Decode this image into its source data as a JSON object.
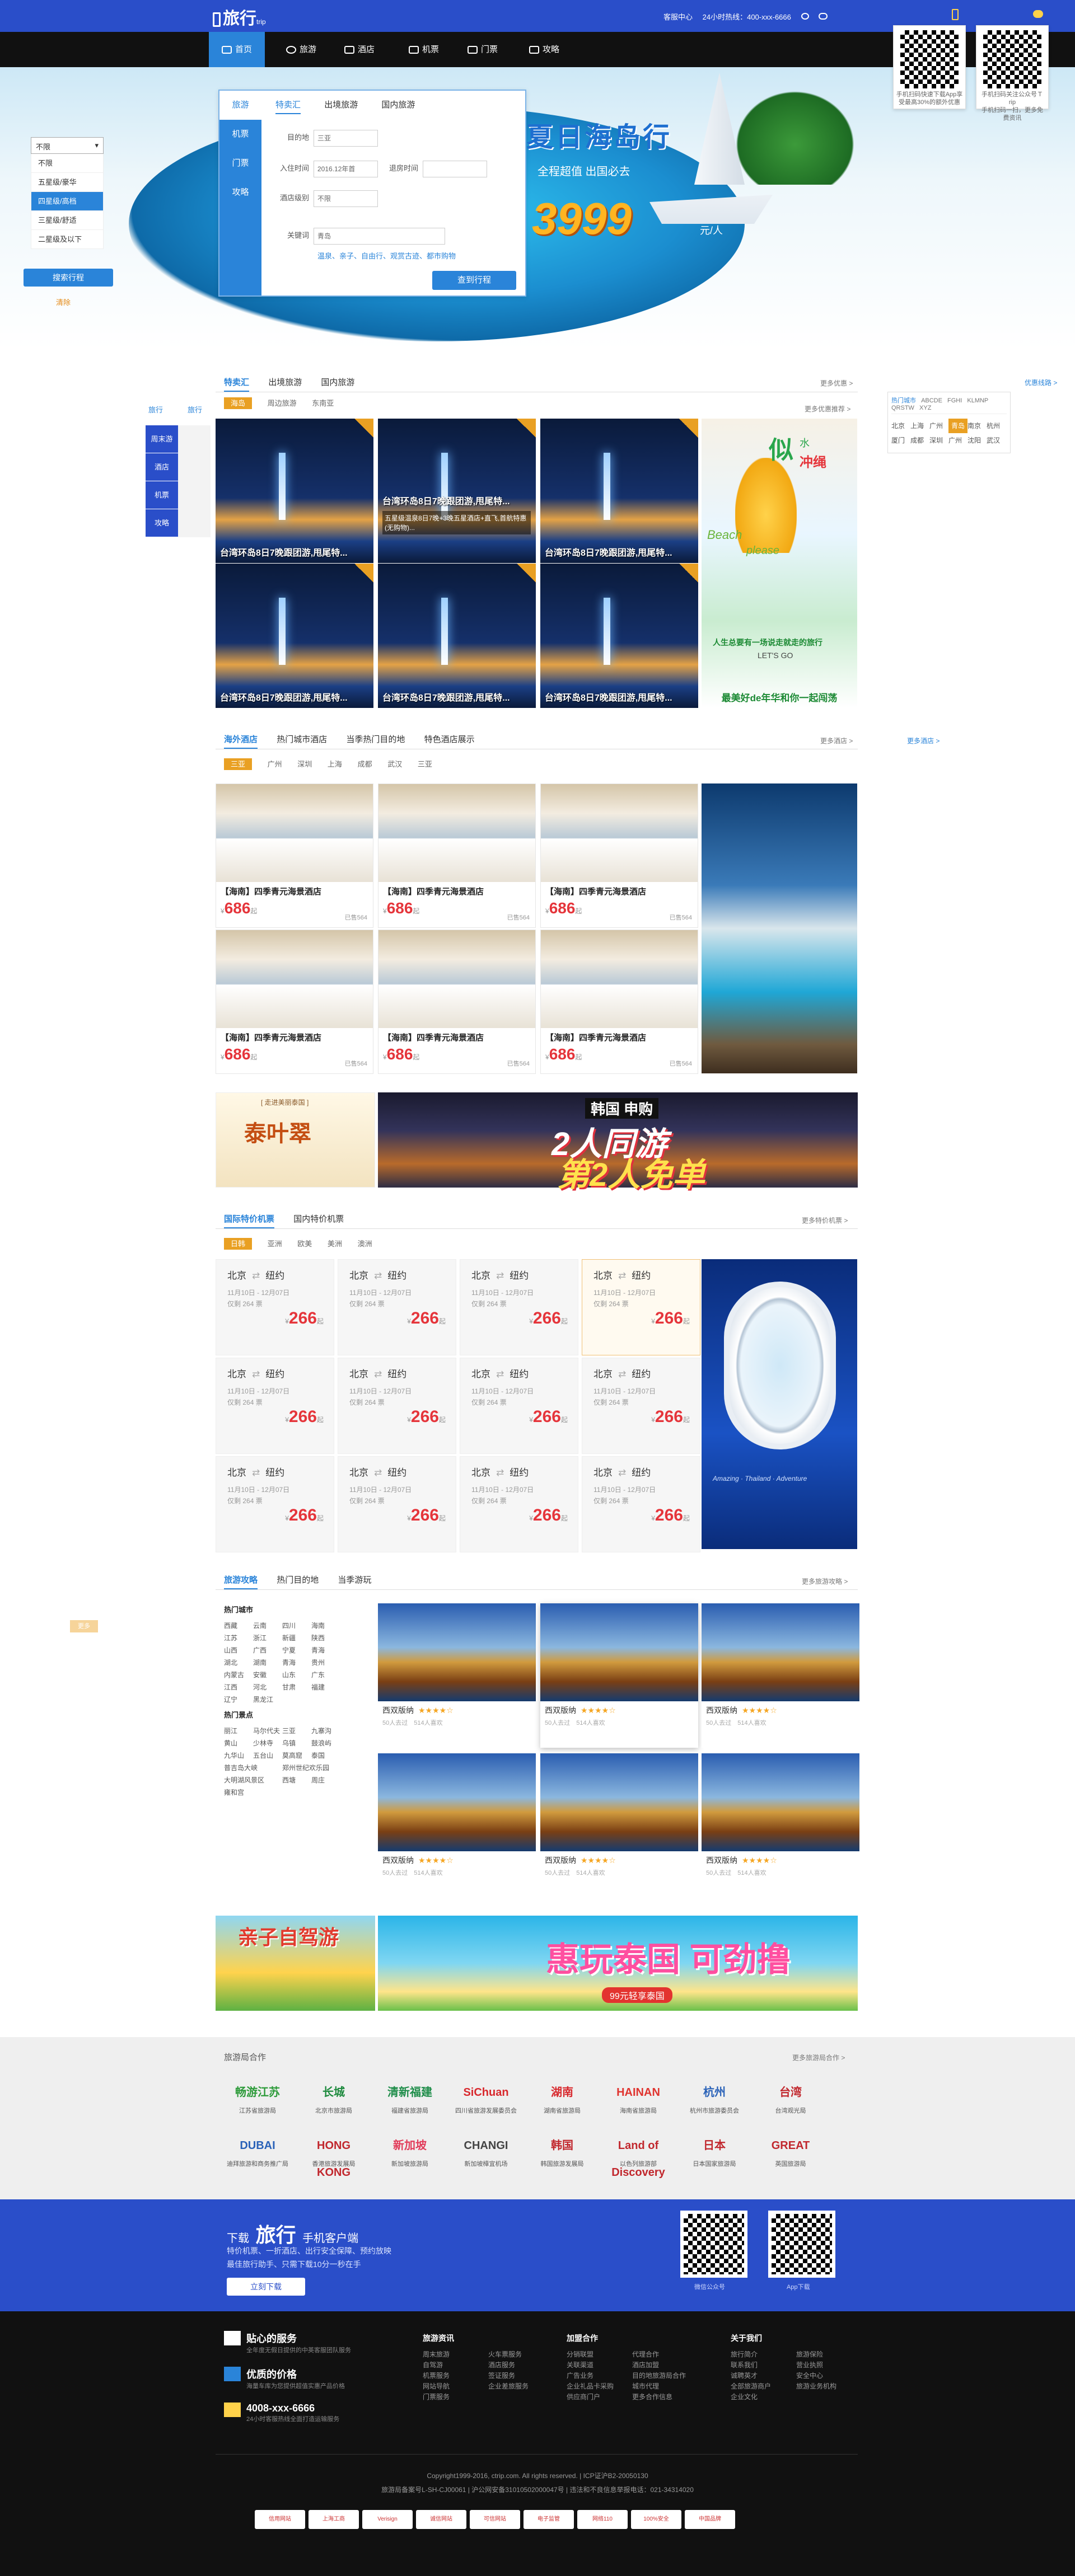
{
  "brand": {
    "name": "旅行",
    "sub": "trip"
  },
  "toplinks": [
    "客服中心",
    "24小时热线：400-xxx-6666"
  ],
  "nav": [
    "首页",
    "旅游",
    "酒店",
    "机票",
    "门票",
    "攻略"
  ],
  "qr_left": {
    "text": "手机扫码快速下载App享受最高30%的额外优惠"
  },
  "qr_right": {
    "text": "手机扫码关注公众号Ｔrip",
    "text2": "手机扫码一扫，更多免费资讯"
  },
  "hero": {
    "title": "夏日海岛行",
    "sub": "全程超值 出国必去",
    "price": "3999",
    "unit": "元/人"
  },
  "search": {
    "left": [
      "旅游",
      "机票",
      "门票",
      "攻略"
    ],
    "tabs": [
      "特卖汇",
      "出境旅游",
      "国内旅游"
    ],
    "dest_label": "目的地",
    "dest_value": "三亚",
    "date_label": "入住时间",
    "date_value": "2016.12年首",
    "leave_label": "退房时间",
    "star_label": "酒店级别",
    "star_value": "不限",
    "key_label": "关键词",
    "key_value": "青岛",
    "hot": "温泉、亲子、自由行、观赏古迹、都市购物",
    "btn": "查到行程"
  },
  "leftsel": {
    "value": "不限",
    "options": [
      "不限",
      "五星级/豪华",
      "四星级/高档",
      "三星级/舒适",
      "二星级及以下"
    ],
    "btn": "搜索行程",
    "link": "清除"
  },
  "tehui": {
    "tabs": [
      "特卖汇",
      "出境旅游",
      "国内旅游"
    ],
    "more": "更多优惠 >",
    "sub": [
      "海岛",
      "周边旅游",
      "东南亚"
    ],
    "more2": "更多优惠推荐 >"
  },
  "tiles": [
    "台湾环岛8日7晚跟团游,甩尾特...",
    "台湾环岛8日7晚跟团游,甩尾特...",
    "台湾环岛8日7晚跟团游,甩尾特...",
    "台湾环岛8日7晚跟团游,甩尾特...",
    "台湾环岛8日7晚跟团游,甩尾特...",
    "台湾环岛8日7晚跟团游,甩尾特..."
  ],
  "tile_hover": "五星级温泉8日7晚+3晚五星酒店+直飞,首航特惠(无购物)...",
  "adpine": {
    "t1": "似",
    "t2": "水",
    "t3": "冲绳",
    "t4": "Beach",
    "t5": "please",
    "t6": "人生总要有一场说走就走的旅行",
    "t7": "LET'S GO",
    "foot": "最美好de年华和你一起闯荡"
  },
  "hotcity": {
    "tabs": [
      "热门城市",
      "ABCDE",
      "FGHI",
      "KLMNP",
      "QRSTW",
      "XYZ"
    ],
    "cities": [
      "北京",
      "上海",
      "广州",
      "青岛",
      "南京",
      "杭州",
      "厦门",
      "成都",
      "深圳",
      "广州",
      "沈阳",
      "武汉"
    ],
    "more": "优惠线路 >"
  },
  "sidetab": [
    "旅行",
    "旅行"
  ],
  "sidebtns": [
    "周末游",
    "酒店",
    "机票",
    "攻略"
  ],
  "hotel": {
    "tabs": [
      "海外酒店",
      "热门城市酒店",
      "当季热门目的地",
      "特色酒店展示"
    ],
    "more": "更多酒店 >",
    "more2": "更多酒店 >",
    "cities": [
      "三亚",
      "广州",
      "深圳",
      "上海",
      "成都",
      "武汉",
      "三亚"
    ]
  },
  "hotels": [
    {
      "t": "【海南】四季青元海景酒店",
      "p": "686",
      "s": "已售564"
    },
    {
      "t": "【海南】四季青元海景酒店",
      "p": "686",
      "s": "已售564"
    },
    {
      "t": "【海南】四季青元海景酒店",
      "p": "686",
      "s": "已售564"
    },
    {
      "t": "【海南】四季青元海景酒店",
      "p": "686",
      "s": "已售564"
    },
    {
      "t": "【海南】四季青元海景酒店",
      "p": "686",
      "s": "已售564"
    },
    {
      "t": "【海南】四季青元海景酒店",
      "p": "686",
      "s": "已售564"
    }
  ],
  "price_suffix": "起",
  "currency": "¥",
  "banner1": {
    "t": "泰叶翠",
    "sub": "[ 走进美丽泰国 ]"
  },
  "banner2": {
    "t1": "韩国 申购",
    "t2": "2人同游",
    "t3": "第2人免单"
  },
  "flight": {
    "tabs": [
      "国际特价机票",
      "国内特价机票"
    ],
    "more": "更多特价机票 >",
    "sub": [
      "日韩",
      "亚洲",
      "欧美",
      "美洲",
      "澳洲"
    ]
  },
  "flights": [
    {
      "from": "北京",
      "to": "纽约",
      "date": "11月10日 - 12月07日",
      "label": "仅剩",
      "n": "264",
      "unit": "票",
      "p": "266"
    },
    {
      "from": "北京",
      "to": "纽约",
      "date": "11月10日 - 12月07日",
      "label": "仅剩",
      "n": "264",
      "unit": "票",
      "p": "266"
    },
    {
      "from": "北京",
      "to": "纽约",
      "date": "11月10日 - 12月07日",
      "label": "仅剩",
      "n": "264",
      "unit": "票",
      "p": "266"
    },
    {
      "from": "北京",
      "to": "纽约",
      "date": "11月10日 - 12月07日",
      "label": "仅剩",
      "n": "264",
      "unit": "票",
      "p": "266"
    },
    {
      "from": "北京",
      "to": "纽约",
      "date": "11月10日 - 12月07日",
      "label": "仅剩",
      "n": "264",
      "unit": "票",
      "p": "266"
    },
    {
      "from": "北京",
      "to": "纽约",
      "date": "11月10日 - 12月07日",
      "label": "仅剩",
      "n": "264",
      "unit": "票",
      "p": "266"
    },
    {
      "from": "北京",
      "to": "纽约",
      "date": "11月10日 - 12月07日",
      "label": "仅剩",
      "n": "264",
      "unit": "票",
      "p": "266"
    },
    {
      "from": "北京",
      "to": "纽约",
      "date": "11月10日 - 12月07日",
      "label": "仅剩",
      "n": "264",
      "unit": "票",
      "p": "266"
    },
    {
      "from": "北京",
      "to": "纽约",
      "date": "11月10日 - 12月07日",
      "label": "仅剩",
      "n": "264",
      "unit": "票",
      "p": "266"
    },
    {
      "from": "北京",
      "to": "纽约",
      "date": "11月10日 - 12月07日",
      "label": "仅剩",
      "n": "264",
      "unit": "票",
      "p": "266"
    },
    {
      "from": "北京",
      "to": "纽约",
      "date": "11月10日 - 12月07日",
      "label": "仅剩",
      "n": "264",
      "unit": "票",
      "p": "266"
    },
    {
      "from": "北京",
      "to": "纽约",
      "date": "11月10日 - 12月07日",
      "label": "仅剩",
      "n": "264",
      "unit": "票",
      "p": "266"
    }
  ],
  "plane_caption": "Amazing · Thailand · Adventure",
  "guide": {
    "tabs": [
      "旅游攻略",
      "热门目的地",
      "当季游玩"
    ],
    "more": "更多旅游攻略 >",
    "side_badge": "更多"
  },
  "guide_left": {
    "h1": "热门城市",
    "cities": [
      "西藏",
      "云南",
      "四川",
      "海南",
      "江苏",
      "浙江",
      "新疆",
      "陕西",
      "山西",
      "广西",
      "宁夏",
      "青海",
      "湖北",
      "湖南",
      "青海",
      "贵州",
      "内蒙古",
      "安徽",
      "山东",
      "广东",
      "江西",
      "河北",
      "甘肃",
      "福建",
      "辽宁",
      "黑龙江"
    ],
    "h2": "热门景点",
    "spots": [
      "丽江",
      "马尔代夫",
      "三亚",
      "九寨沟",
      "黄山",
      "少林寺",
      "乌镇",
      "鼓浪屿",
      "九华山",
      "五台山",
      "莫高窟",
      "",
      "泰国",
      "普吉岛大峡",
      "",
      "郑州世纪欢乐园",
      "大明湖风景区",
      "",
      "西塘",
      "周庄",
      "雍和宫"
    ]
  },
  "guides": [
    {
      "t": "西双版纳",
      "n": "50人去过",
      "c": "514人喜欢"
    },
    {
      "t": "西双版纳",
      "n": "50人去过",
      "c": "514人喜欢"
    },
    {
      "t": "西双版纳",
      "n": "50人去过",
      "c": "514人喜欢"
    },
    {
      "t": "西双版纳",
      "n": "50人去过",
      "c": "514人喜欢"
    },
    {
      "t": "西双版纳",
      "n": "50人去过",
      "c": "514人喜欢"
    },
    {
      "t": "西双版纳",
      "n": "50人去过",
      "c": "514人喜欢"
    }
  ],
  "stars": "★★★★☆",
  "ban3": {
    "t": "亲子自驾游"
  },
  "ban4": {
    "t": "惠玩泰国 可劲撸",
    "sub": "99元轻享泰国"
  },
  "partners": {
    "title": "旅游局合作",
    "more": "更多旅游局合作 >",
    "items": [
      {
        "lg": "畅游江苏",
        "n": "江苏省旅游局"
      },
      {
        "lg": "长城",
        "n": "北京市旅游局"
      },
      {
        "lg": "清新福建",
        "n": "福建省旅游局"
      },
      {
        "lg": "SiChuan",
        "n": "四川省旅游发展委员会"
      },
      {
        "lg": "湖南",
        "n": "湖南省旅游局"
      },
      {
        "lg": "HAINAN",
        "n": "海南省旅游局"
      },
      {
        "lg": "杭州",
        "n": "杭州市旅游委员会"
      },
      {
        "lg": "台湾",
        "n": "台湾观光局"
      },
      {
        "lg": "DUBAI",
        "n": "迪拜旅游和商务推广局"
      },
      {
        "lg": "HONG KONG",
        "n": "香港旅游发展局"
      },
      {
        "lg": "新加坡",
        "n": "新加坡旅游局"
      },
      {
        "lg": "CHANGI",
        "n": "新加坡樟宜机场"
      },
      {
        "lg": "韩国",
        "n": "韩国旅游发展局"
      },
      {
        "lg": "Land of Discovery",
        "n": "以色列旅游部"
      },
      {
        "lg": "日本",
        "n": "日本国家旅游局"
      },
      {
        "lg": "GREAT",
        "n": "英国旅游局"
      }
    ]
  },
  "app": {
    "label": "下载",
    "brand": "旅行",
    "tail": "手机客户端",
    "desc": "特价机票、一折酒店、出行安全保障、预约放映",
    "desc2": "最佳旅行助手、只需下载10分一秒在手",
    "btn": "立刻下载",
    "qr1": "微信公众号",
    "qr2": "App下载"
  },
  "footer": {
    "svc": [
      {
        "t": "贴心的服务",
        "d": "全年度无假日提供的中英客服团队服务"
      },
      {
        "t": "优质的价格",
        "d": "海量车库为您提供超值实惠产品价格"
      },
      {
        "t": "4008-xxx-6666",
        "d": "24小时客服热线全面打造运输服务"
      }
    ],
    "cols": [
      {
        "h": "旅游资讯",
        "items": [
          "周末旅游",
          "自驾游",
          "机票服务",
          "网站导航",
          "门票服务",
          "火车票服务",
          "酒店服务",
          "签证服务",
          "企业差旅服务"
        ]
      },
      {
        "h": "加盟合作",
        "items": [
          "分销联盟",
          "关联渠道",
          "广告业务",
          "企业礼品卡采购",
          "供应商门户",
          "代理合作",
          "酒店加盟",
          "目的地旅游局合作",
          "城市代理",
          "更多合作信息"
        ]
      },
      {
        "h": "关于我们",
        "items": [
          "旅行简介",
          "联系我们",
          "诚聘英才",
          "全部旅游商户",
          "企业文化",
          "旅游保险",
          "营业执照",
          "安全中心",
          "旅游业务机构"
        ]
      }
    ],
    "copy": "Copyright1999-2016, ctrip.com. All rights reserved. | ICP证沪B2-20050130",
    "copy2": "旅游局备案号L-SH-CJ00061 | 沪公网安备31010502000047号 | 违法和不良信息举报电话：021-34314020",
    "badges": [
      "信用网站",
      "上海工商",
      "Verisign",
      "诚信网站",
      "可信网站",
      "电子监管",
      "网络110",
      "100%安全",
      "中国品牌"
    ]
  }
}
